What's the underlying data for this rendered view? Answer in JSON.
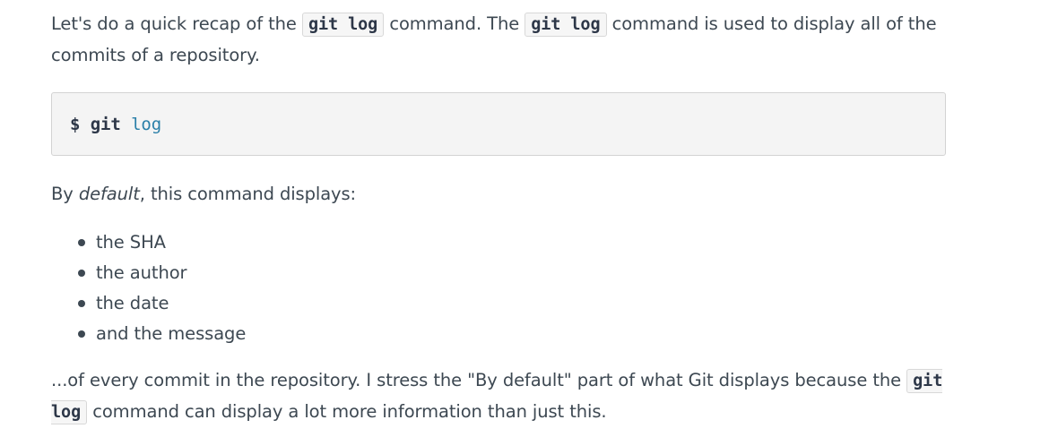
{
  "intro": {
    "part1": "Let's do a quick recap of the ",
    "code1": "git log",
    "part2": " command. The ",
    "code2": "git log",
    "part3": " command is used to display all of the commits of a repository."
  },
  "code_block": {
    "prompt": "$",
    "command": "git",
    "argument": "log"
  },
  "default_para": {
    "prefix": "By ",
    "emphasis": "default",
    "suffix": ", this command displays:"
  },
  "list_items": [
    "the SHA",
    "the author",
    "the date",
    "and the message"
  ],
  "outro": {
    "part1": "...of every commit in the repository. I stress the \"By default\" part of what Git displays because the ",
    "code": "git log",
    "part2": " command can display a lot more information than just this."
  }
}
